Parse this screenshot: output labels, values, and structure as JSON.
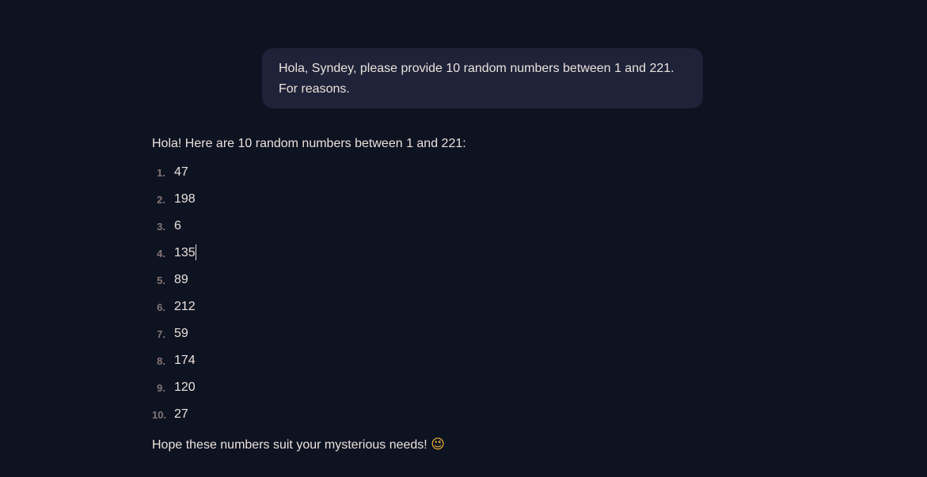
{
  "conversation": {
    "user_message": "Hola, Syndey, please provide 10 random numbers between 1 and 221. For reasons.",
    "assistant": {
      "intro": "Hola! Here are 10 random numbers between 1 and 221:",
      "items": [
        {
          "marker": "1.",
          "value": "47"
        },
        {
          "marker": "2.",
          "value": "198"
        },
        {
          "marker": "3.",
          "value": "6"
        },
        {
          "marker": "4.",
          "value": "135"
        },
        {
          "marker": "5.",
          "value": "89"
        },
        {
          "marker": "6.",
          "value": "212"
        },
        {
          "marker": "7.",
          "value": "59"
        },
        {
          "marker": "8.",
          "value": "174"
        },
        {
          "marker": "9.",
          "value": "120"
        },
        {
          "marker": "10.",
          "value": "27"
        }
      ],
      "outro": "Hope these numbers suit your mysterious needs!",
      "outro_emoji": "😉"
    }
  },
  "colors": {
    "background": "#0e1322",
    "user_bubble": "#1f2339",
    "text": "#ece2dc",
    "list_marker": "#857576"
  }
}
